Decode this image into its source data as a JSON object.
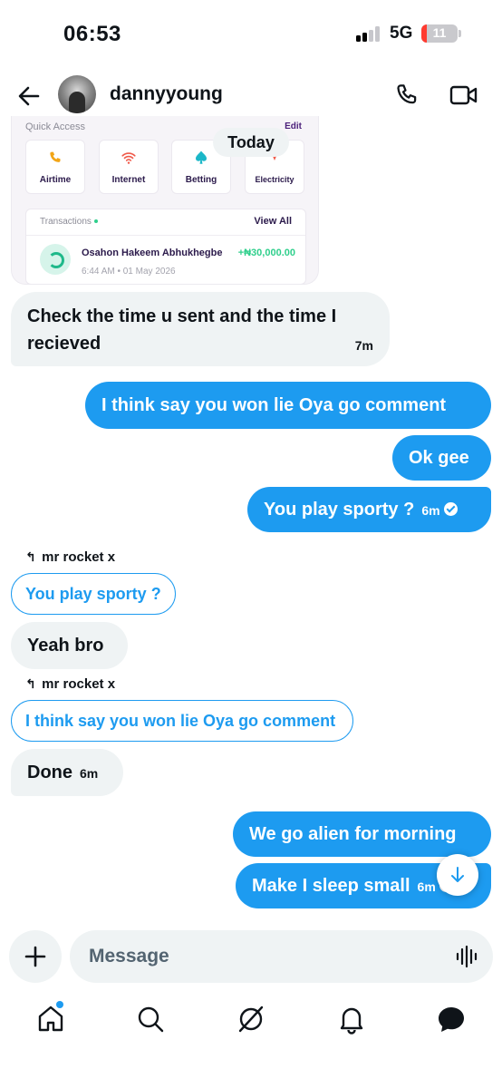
{
  "status_bar": {
    "time": "06:53",
    "network": "5G",
    "battery": "11"
  },
  "header": {
    "contact_name": "dannyyoung"
  },
  "shared_image": {
    "quick_access_title": "Quick Access",
    "edit_label": "Edit",
    "tiles": [
      {
        "label": "Airtime",
        "icon": "phone-icon"
      },
      {
        "label": "Internet",
        "icon": "wifi-icon"
      },
      {
        "label": "Betting",
        "icon": "spade-icon"
      },
      {
        "label": "Electricity",
        "icon": "bulb-icon"
      }
    ],
    "transactions_title": "Transactions",
    "view_all": "View All",
    "transaction": {
      "name": "Osahon Hakeem Abhukhegbe",
      "amount": "+₦30,000.00",
      "date": "6:44 AM • 01 May 2026"
    }
  },
  "date_divider": "Today",
  "messages": [
    {
      "id": "m1",
      "direction": "received",
      "lines": [
        "Check the time u sent and the time I",
        "recieved"
      ],
      "time": "7m"
    },
    {
      "id": "m2",
      "direction": "sent",
      "text": "I think say you won lie Oya go comment"
    },
    {
      "id": "m3",
      "direction": "sent",
      "text": "Ok gee"
    },
    {
      "id": "m4",
      "direction": "sent",
      "text": "You play sporty ?",
      "time": "6m"
    },
    {
      "id": "m5",
      "direction": "received",
      "reply_to_author": "mr rocket x",
      "quoted_text": "You play sporty ?",
      "text": "Yeah bro"
    },
    {
      "id": "m6",
      "direction": "received",
      "reply_to_author": "mr rocket x",
      "quoted_text": "I think say you won lie Oya go comment",
      "text": "Done",
      "time": "6m"
    },
    {
      "id": "m7",
      "direction": "sent",
      "text": "We go alien for morning"
    },
    {
      "id": "m8",
      "direction": "sent",
      "text": "Make I sleep small",
      "time": "6m"
    }
  ],
  "composer": {
    "placeholder": "Message"
  },
  "tabbar": {
    "items": [
      "home-icon",
      "search-icon",
      "grok-icon",
      "bell-icon",
      "messages-icon"
    ]
  },
  "colors": {
    "accent": "#1d9bf0",
    "bubble_received": "#eff3f4",
    "text": "#0f1419",
    "placeholder": "#536471"
  }
}
